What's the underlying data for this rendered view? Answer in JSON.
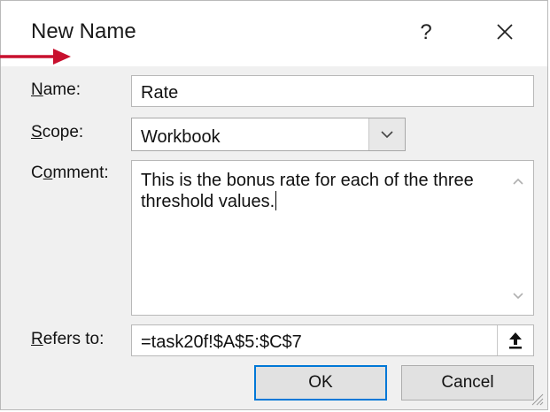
{
  "dialog": {
    "title": "New Name",
    "help_label": "?",
    "close_icon": "close-icon"
  },
  "fields": {
    "name": {
      "label_accel": "N",
      "label_rest": "ame:",
      "value": "Rate"
    },
    "scope": {
      "label_accel": "S",
      "label_rest": "cope:",
      "value": "Workbook",
      "options_icon": "chevron-down-icon"
    },
    "comment": {
      "label_pre": "C",
      "label_accel": "o",
      "label_rest": "mment:",
      "value": "This is the bonus rate for each of the three threshold values."
    },
    "refers_to": {
      "label_accel": "R",
      "label_rest": "efers to:",
      "value": "=task20f!$A$5:$C$7",
      "collapse_icon": "collapse-dialog-icon"
    }
  },
  "buttons": {
    "ok": "OK",
    "cancel": "Cancel"
  },
  "annotation": {
    "arrow_color": "#c8102e",
    "arrow_icon": "pointer-arrow-icon"
  },
  "colors": {
    "focus": "#0078d7",
    "dialog_bg": "#f0f0f0"
  }
}
